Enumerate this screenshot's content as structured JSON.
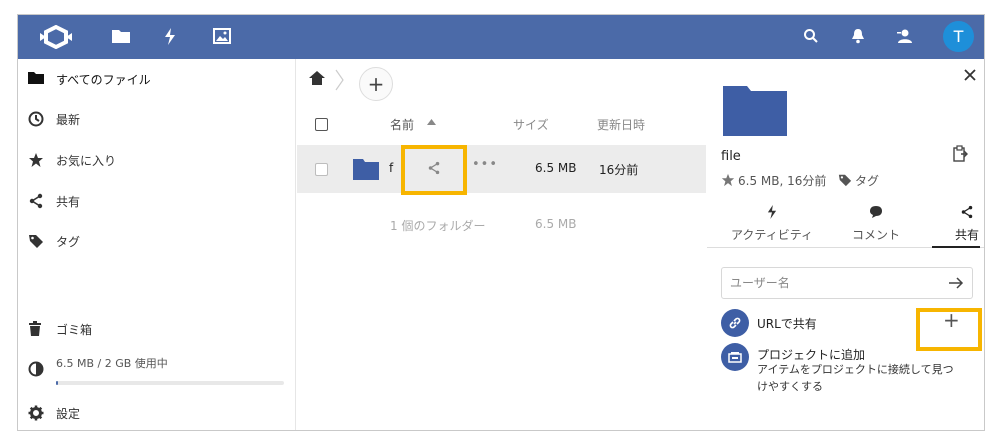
{
  "colors": {
    "header": "#4b6aa8",
    "accent": "#1e8fd9",
    "highlight": "#f7b500",
    "folder": "#3e5ea5"
  },
  "header": {
    "avatar_letter": "T",
    "apps": [
      "files-icon",
      "activity-icon",
      "gallery-icon"
    ],
    "icons": [
      "search-icon",
      "bell-icon",
      "contacts-icon"
    ]
  },
  "sidebar": {
    "items": [
      {
        "label": "すべてのファイル",
        "icon": "folder-icon"
      },
      {
        "label": "最新",
        "icon": "clock-icon"
      },
      {
        "label": "お気に入り",
        "icon": "star-icon"
      },
      {
        "label": "共有",
        "icon": "share-icon"
      },
      {
        "label": "タグ",
        "icon": "tag-icon"
      }
    ],
    "trash": "ゴミ箱",
    "quota": "6.5 MB / 2 GB 使用中",
    "quota_fraction": 0.003,
    "settings": "設定"
  },
  "files": {
    "columns": {
      "name": "名前",
      "size": "サイズ",
      "modified": "更新日時"
    },
    "rows": [
      {
        "name": "f",
        "size": "6.5 MB",
        "modified": "16分前"
      }
    ],
    "summary": {
      "count": "1 個のフォルダー",
      "size": "6.5 MB"
    }
  },
  "details": {
    "filename": "file",
    "meta": "6.5 MB, 16分前",
    "tags_label": "タグ",
    "tabs": [
      "アクティビティ",
      "コメント",
      "共有"
    ],
    "share_placeholder": "ユーザー名",
    "url_share": "URLで共有",
    "project_title": "プロジェクトに追加",
    "project_desc_1": "アイテムをプロジェクトに接続して見つ",
    "project_desc_2": "けやすくする"
  }
}
